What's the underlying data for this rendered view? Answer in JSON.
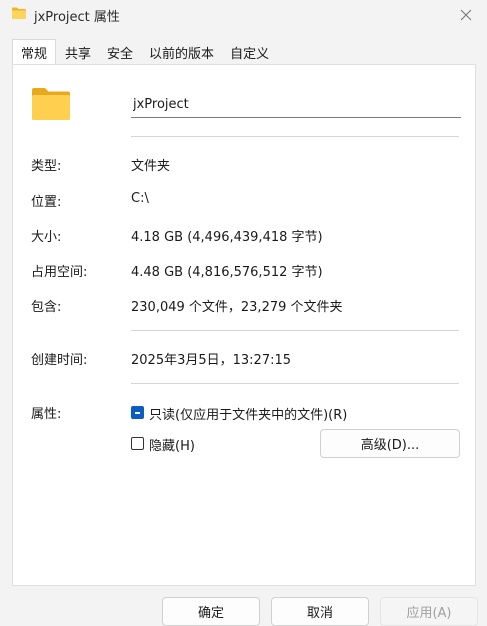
{
  "window": {
    "title": "jxProject 属性"
  },
  "tabs": [
    {
      "label": "常规",
      "active": true
    },
    {
      "label": "共享"
    },
    {
      "label": "安全"
    },
    {
      "label": "以前的版本"
    },
    {
      "label": "自定义"
    }
  ],
  "general": {
    "name_value": "jxProject",
    "rows": {
      "type": {
        "label": "类型:",
        "value": "文件夹"
      },
      "location": {
        "label": "位置:",
        "value": "C:\\"
      },
      "size": {
        "label": "大小:",
        "value": "4.18 GB (4,496,439,418 字节)"
      },
      "size_on_disk": {
        "label": "占用空间:",
        "value": "4.48 GB (4,816,576,512 字节)"
      },
      "contains": {
        "label": "包含:",
        "value": "230,049 个文件，23,279 个文件夹"
      },
      "created": {
        "label": "创建时间:",
        "value": "2025年3月5日，13:27:15"
      }
    },
    "attributes": {
      "label": "属性:",
      "readonly_label": "只读(仅应用于文件夹中的文件)(R)",
      "readonly_state": "indeterminate",
      "hidden_label": "隐藏(H)",
      "hidden_checked": false,
      "advanced_label": "高级(D)..."
    }
  },
  "footer": {
    "ok_label": "确定",
    "cancel_label": "取消",
    "apply_label": "应用(A)"
  },
  "colors": {
    "accent": "#0a5dc2",
    "folder": "#f5c445"
  }
}
